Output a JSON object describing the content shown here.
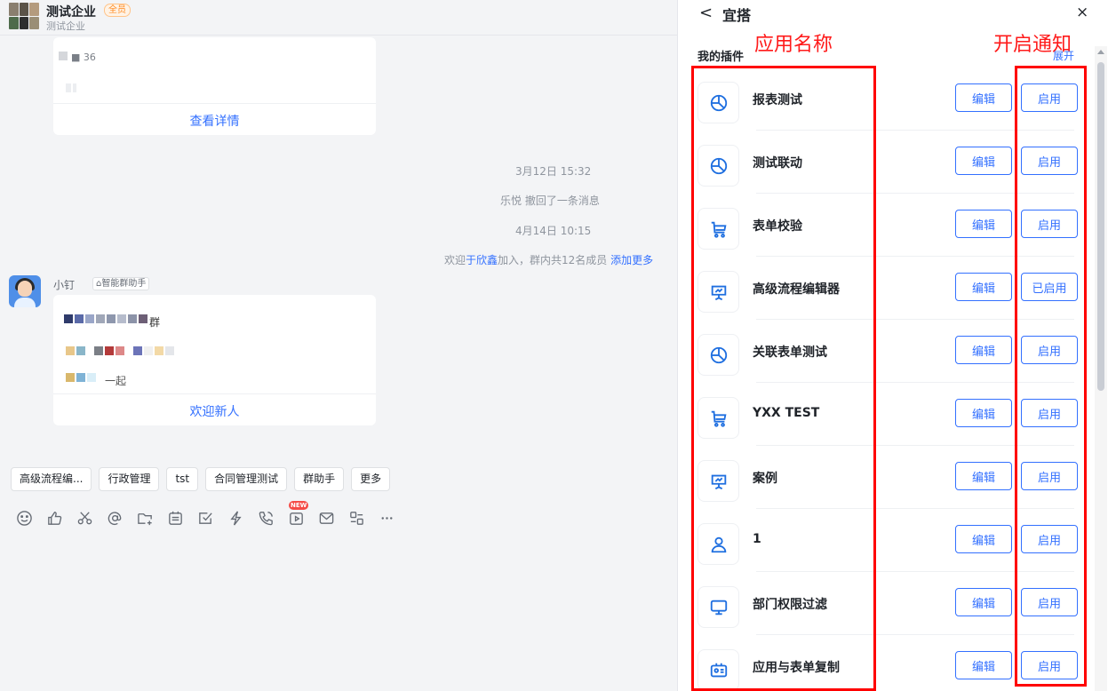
{
  "chat": {
    "group_name": "测试企业",
    "member_badge": "全员",
    "group_subtitle": "测试企业",
    "top_card": {
      "blur_line1": "■ 36",
      "link": "查看详情"
    },
    "system": {
      "time1": "3月12日 15:32",
      "recall": "乐悦 撤回了一条消息",
      "time2": "4月14日 10:15",
      "welcome_prefix": "欢迎",
      "welcome_user": "于欣鑫",
      "welcome_mid": "加入，群内共12名成员",
      "welcome_link": "添加更多"
    },
    "sender": {
      "name": "小钉",
      "tag": "智能群助手"
    },
    "bot_card": {
      "blur_tail": "群",
      "blur_line3": "一起",
      "link": "欢迎新人"
    },
    "quick_actions": [
      "高级流程编...",
      "行政管理",
      "tst",
      "合同管理测试",
      "群助手",
      "更多"
    ],
    "toolbar_icons": [
      "emoji-icon",
      "thumbs-up-icon",
      "scissors-icon",
      "at-icon",
      "add-folder-icon",
      "calendar-icon",
      "checkbox-icon",
      "lightning-icon",
      "phone-icon",
      "video-icon",
      "mail-icon",
      "layout-icon",
      "more-icon"
    ],
    "new_badge": "NEW"
  },
  "panel": {
    "back_label": "<",
    "title": "宜搭",
    "close_label": "×",
    "section_title": "我的插件",
    "expand_label": "展开",
    "annotation_name": "应用名称",
    "annotation_notify": "开启通知",
    "edit_label": "编辑",
    "plugins": [
      {
        "name": "报表测试",
        "icon": "chart-icon",
        "status": "启用"
      },
      {
        "name": "测试联动",
        "icon": "chart-icon",
        "status": "启用"
      },
      {
        "name": "表单校验",
        "icon": "cart-icon",
        "status": "启用"
      },
      {
        "name": "高级流程编辑器",
        "icon": "presentation-icon",
        "status": "已启用"
      },
      {
        "name": "关联表单测试",
        "icon": "chart-icon",
        "status": "启用"
      },
      {
        "name": "YXX TEST",
        "icon": "cart-icon",
        "status": "启用"
      },
      {
        "name": "案例",
        "icon": "presentation-icon",
        "status": "启用"
      },
      {
        "name": "1",
        "icon": "user-icon",
        "status": "启用"
      },
      {
        "name": "部门权限过滤",
        "icon": "monitor-icon",
        "status": "启用"
      },
      {
        "name": "应用与表单复制",
        "icon": "id-card-icon",
        "status": "启用"
      }
    ],
    "colors": {
      "accent": "#3370ff",
      "annotation": "#ff0000"
    }
  }
}
